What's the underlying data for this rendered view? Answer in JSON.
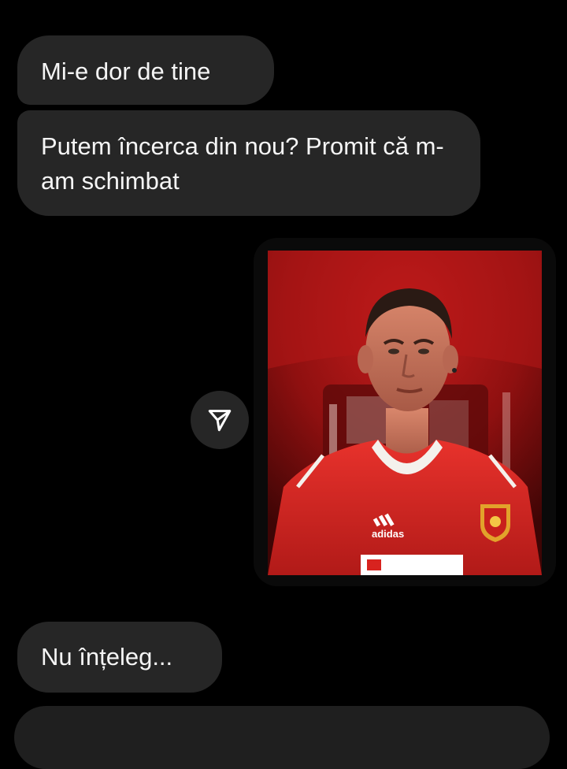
{
  "messages": [
    {
      "text": "Mi-e dor de tine"
    },
    {
      "text": "Putem încerca din nou? Promit că m-am schimbat"
    },
    {
      "text": "Nu înțeleg..."
    }
  ],
  "shared_post": {
    "share_icon": "paper-plane-icon",
    "jersey_brand": "adidas"
  },
  "colors": {
    "background": "#000000",
    "bubble": "#262626",
    "text": "#f5f5f5",
    "jersey_red": "#d8231f"
  }
}
